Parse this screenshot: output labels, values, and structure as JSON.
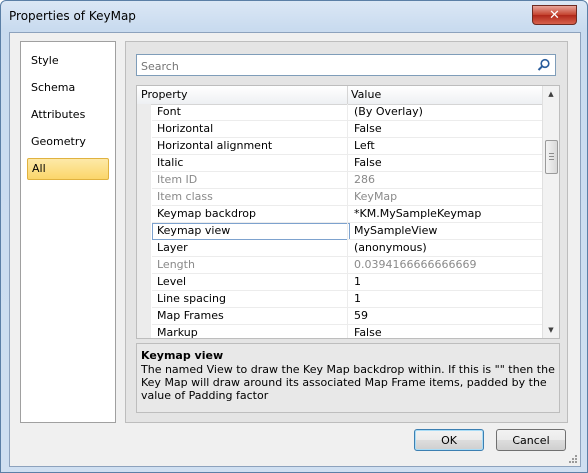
{
  "window": {
    "title": "Properties of KeyMap",
    "close_glyph": "✕"
  },
  "nav": {
    "items": [
      {
        "label": "Style"
      },
      {
        "label": "Schema"
      },
      {
        "label": "Attributes"
      },
      {
        "label": "Geometry"
      },
      {
        "label": "All",
        "selected": true
      }
    ]
  },
  "search": {
    "placeholder": "Search",
    "value": "",
    "icon": "search-icon"
  },
  "grid": {
    "headers": {
      "property": "Property",
      "value": "Value"
    },
    "rows": [
      {
        "property": "Font",
        "value": "(By Overlay)",
        "readonly": false
      },
      {
        "property": "Horizontal",
        "value": "False",
        "readonly": false
      },
      {
        "property": "Horizontal alignment",
        "value": "Left",
        "readonly": false
      },
      {
        "property": "Italic",
        "value": "False",
        "readonly": false
      },
      {
        "property": "Item ID",
        "value": "286",
        "readonly": true
      },
      {
        "property": "Item class",
        "value": "KeyMap",
        "readonly": true
      },
      {
        "property": "Keymap backdrop",
        "value": "*KM.MySampleKeymap",
        "readonly": false
      },
      {
        "property": "Keymap view",
        "value": "MySampleView",
        "readonly": false,
        "focused": true
      },
      {
        "property": "Layer",
        "value": "(anonymous)",
        "readonly": false
      },
      {
        "property": "Length",
        "value": "0.0394166666666669",
        "readonly": true
      },
      {
        "property": "Level",
        "value": "1",
        "readonly": false
      },
      {
        "property": "Line spacing",
        "value": "1",
        "readonly": false
      },
      {
        "property": "Map Frames",
        "value": "59",
        "readonly": false
      },
      {
        "property": "Markup",
        "value": "False",
        "readonly": false
      }
    ]
  },
  "description": {
    "title": "Keymap view",
    "text": "The named View to draw the Key Map backdrop within. If this is \"\" then the Key Map will draw around its associated Map Frame items, padded by the value of Padding factor"
  },
  "buttons": {
    "ok": "OK",
    "cancel": "Cancel"
  },
  "colors": {
    "selection": "#fbd66a",
    "close_button": "#c4412d",
    "readonly_text": "#8a8a8a"
  }
}
